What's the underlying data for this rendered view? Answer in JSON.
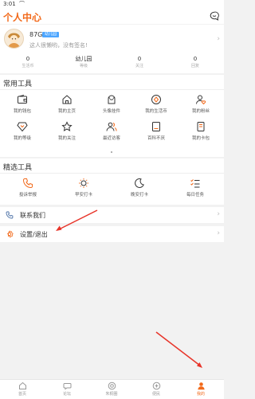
{
  "status_bar": {
    "time": "3:01",
    "status_icon": "notification-icon"
  },
  "header": {
    "title": "个人中心",
    "message_icon": "chat-icon"
  },
  "profile": {
    "username": "87G",
    "badge": "幼儿园",
    "signature": "这人很懒哟，没有签名!",
    "stats": [
      {
        "value": "0",
        "label": "生活币"
      },
      {
        "value": "幼儿园",
        "label": "等级"
      },
      {
        "value": "0",
        "label": "关注"
      },
      {
        "value": "0",
        "label": "回复"
      }
    ]
  },
  "common_tools": {
    "title": "常用工具",
    "items": [
      {
        "label": "我的钱包",
        "icon": "wallet-icon"
      },
      {
        "label": "我的主页",
        "icon": "home-icon"
      },
      {
        "label": "头像挂件",
        "icon": "avatar-frame-icon"
      },
      {
        "label": "我的生活币",
        "icon": "coin-icon"
      },
      {
        "label": "我的粉丝",
        "icon": "fans-icon"
      },
      {
        "label": "我的等级",
        "icon": "diamond-icon"
      },
      {
        "label": "我的关注",
        "icon": "star-icon"
      },
      {
        "label": "最近访客",
        "icon": "visitors-icon"
      },
      {
        "label": "百科不厌",
        "icon": "book-icon"
      },
      {
        "label": "我的卡包",
        "icon": "card-icon"
      }
    ]
  },
  "featured_tools": {
    "title": "精选工具",
    "items": [
      {
        "label": "投诉举报",
        "icon": "phone-icon"
      },
      {
        "label": "早安打卡",
        "icon": "sun-icon"
      },
      {
        "label": "晚安打卡",
        "icon": "moon-icon"
      },
      {
        "label": "每日任务",
        "icon": "checklist-icon"
      }
    ]
  },
  "menu": [
    {
      "label": "联系我们",
      "icon": "contact-icon"
    },
    {
      "label": "设置/退出",
      "icon": "settings-icon"
    }
  ],
  "tabbar": [
    {
      "label": "首页",
      "icon": "home-tab-icon"
    },
    {
      "label": "论坛",
      "icon": "forum-tab-icon"
    },
    {
      "label": "朱桐圈",
      "icon": "circle-tab-icon"
    },
    {
      "label": "便民",
      "icon": "service-tab-icon"
    },
    {
      "label": "我的",
      "icon": "profile-tab-icon"
    }
  ],
  "colors": {
    "accent": "#f26a1b",
    "badge": "#4da6ff",
    "arrow": "#e8352a"
  }
}
